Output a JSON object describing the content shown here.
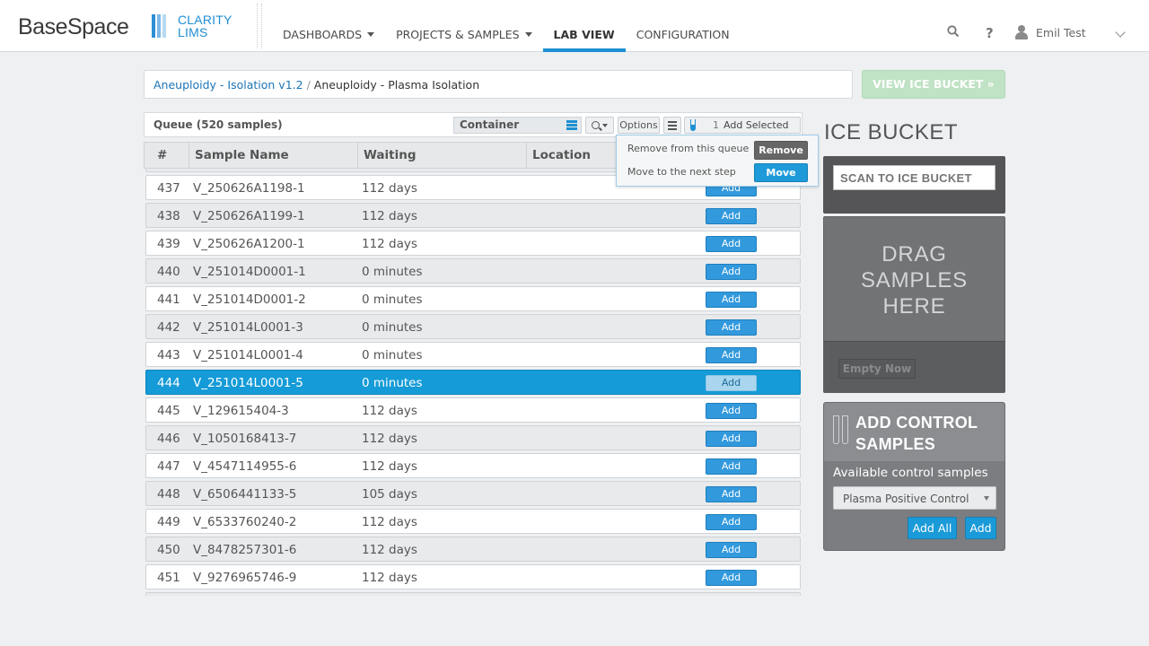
{
  "header": {
    "brand": "BaseSpace",
    "product_line1": "CLARITY",
    "product_line2": "LIMS",
    "nav": [
      {
        "label": "DASHBOARDS",
        "has_dropdown": true,
        "active": false
      },
      {
        "label": "PROJECTS & SAMPLES",
        "has_dropdown": true,
        "active": false
      },
      {
        "label": "LAB VIEW",
        "has_dropdown": false,
        "active": true
      },
      {
        "label": "CONFIGURATION",
        "has_dropdown": false,
        "active": false
      }
    ],
    "search_icon": "search-icon",
    "help_label": "?",
    "user_name": "Emil Test"
  },
  "breadcrumb": {
    "parent": "Aneuploidy - Isolation v1.2",
    "separator": "/",
    "current": "Aneuploidy - Plasma Isolation"
  },
  "view_ice_bucket_label": "VIEW ICE BUCKET »",
  "queue": {
    "title": "Queue (520 samples)",
    "container_label": "Container",
    "options_label": "Options",
    "selected_count": "1",
    "add_selected_label": "Add Selected",
    "columns": [
      "#",
      "Sample Name",
      "Waiting",
      "Location"
    ],
    "add_label": "Add",
    "rows": [
      {
        "num": "437",
        "name": "V_250626A1198-1",
        "waiting": "112 days",
        "selected": false
      },
      {
        "num": "438",
        "name": "V_250626A1199-1",
        "waiting": "112 days",
        "selected": false
      },
      {
        "num": "439",
        "name": "V_250626A1200-1",
        "waiting": "112 days",
        "selected": false
      },
      {
        "num": "440",
        "name": "V_251014D0001-1",
        "waiting": "0 minutes",
        "selected": false
      },
      {
        "num": "441",
        "name": "V_251014D0001-2",
        "waiting": "0 minutes",
        "selected": false
      },
      {
        "num": "442",
        "name": "V_251014L0001-3",
        "waiting": "0 minutes",
        "selected": false
      },
      {
        "num": "443",
        "name": "V_251014L0001-4",
        "waiting": "0 minutes",
        "selected": false
      },
      {
        "num": "444",
        "name": "V_251014L0001-5",
        "waiting": "0 minutes",
        "selected": true
      },
      {
        "num": "445",
        "name": "V_129615404-3",
        "waiting": "112 days",
        "selected": false
      },
      {
        "num": "446",
        "name": "V_1050168413-7",
        "waiting": "112 days",
        "selected": false
      },
      {
        "num": "447",
        "name": "V_4547114955-6",
        "waiting": "112 days",
        "selected": false
      },
      {
        "num": "448",
        "name": "V_6506441133-5",
        "waiting": "105 days",
        "selected": false
      },
      {
        "num": "449",
        "name": "V_6533760240-2",
        "waiting": "112 days",
        "selected": false
      },
      {
        "num": "450",
        "name": "V_8478257301-6",
        "waiting": "112 days",
        "selected": false
      },
      {
        "num": "451",
        "name": "V_9276965746-9",
        "waiting": "112 days",
        "selected": false
      }
    ]
  },
  "options_menu": {
    "remove_text": "Remove from this queue",
    "remove_label": "Remove",
    "move_text": "Move to the next step",
    "move_label": "Move"
  },
  "ice_bucket": {
    "title": "ICE BUCKET",
    "scan_placeholder": "SCAN TO ICE BUCKET",
    "drop_text": [
      "DRAG",
      "SAMPLES",
      "HERE"
    ],
    "empty_label": "Empty Now"
  },
  "controls": {
    "title_line1": "ADD CONTROL",
    "title_line2": "SAMPLES",
    "available_label": "Available control samples",
    "selected_control": "Plasma Positive Control",
    "add_all_label": "Add All",
    "add_label": "Add"
  },
  "colors": {
    "accent": "#1e8fd2",
    "selected_row": "#159bd7",
    "view_ice_bucket_disabled": "#bfe3c4",
    "remove_button": "#666666",
    "move_button": "#1e9ad8"
  }
}
